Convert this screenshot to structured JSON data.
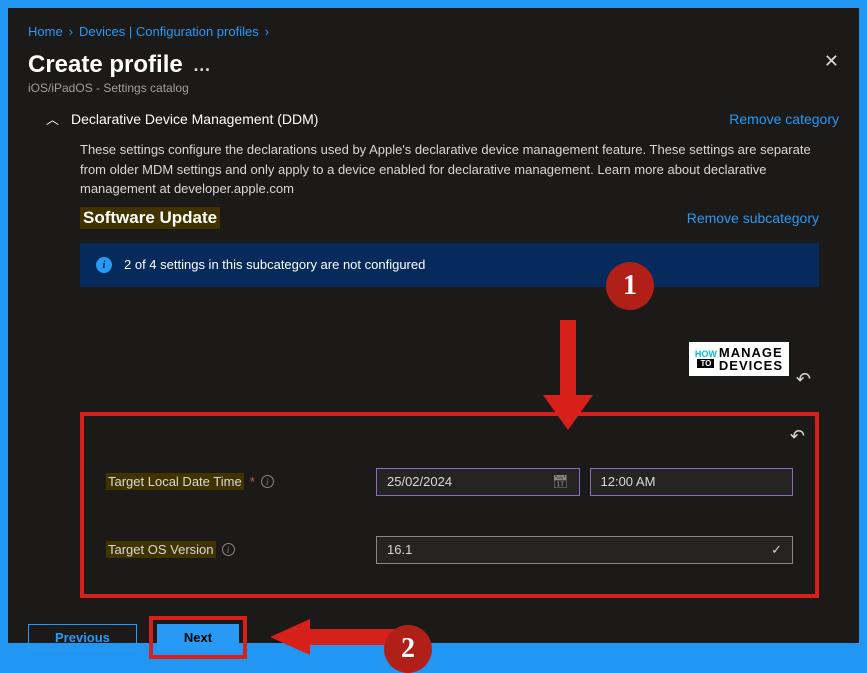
{
  "breadcrumb": {
    "home": "Home",
    "devices": "Devices | Configuration profiles"
  },
  "page": {
    "title": "Create profile",
    "subtitle": "iOS/iPadOS - Settings catalog"
  },
  "section": {
    "title": "Declarative Device Management (DDM)",
    "remove_category": "Remove category",
    "description": "These settings configure the declarations used by Apple's declarative device management feature. These settings are separate from older MDM settings and only apply to a device enabled for declarative management. Learn more about declarative management at developer.apple.com",
    "subsection_title": "Software Update",
    "remove_subcategory": "Remove subcategory",
    "info_banner": "2 of 4 settings in this subcategory are not configured"
  },
  "form": {
    "date_label": "Target Local Date Time",
    "date_value": "25/02/2024",
    "time_value": "12:00 AM",
    "version_label": "Target OS Version",
    "version_value": "16.1"
  },
  "footer": {
    "previous": "Previous",
    "next": "Next"
  },
  "annotations": {
    "one": "1",
    "two": "2"
  },
  "watermark": {
    "how": "HOW",
    "to": "TO",
    "manage": "MANAGE",
    "devices": "DEVICES"
  }
}
